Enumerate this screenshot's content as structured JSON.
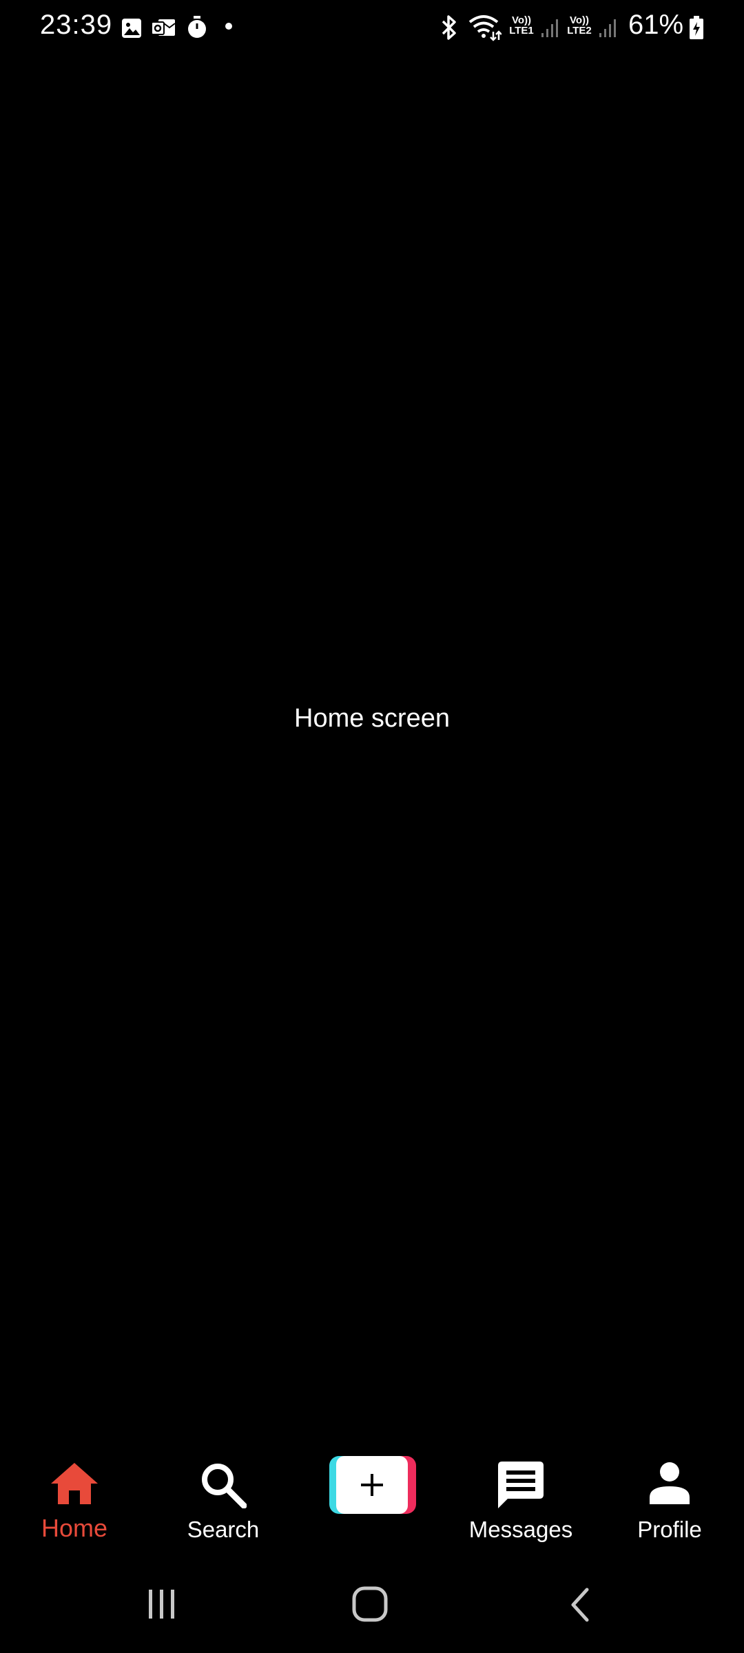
{
  "status_bar": {
    "time": "23:39",
    "notification_icons": [
      "gallery-icon",
      "outlook-icon",
      "timer-icon",
      "dot-icon"
    ],
    "right_icons": [
      "bluetooth-icon",
      "wifi-icon",
      "signal-icon"
    ],
    "sim1_label_top": "Vo))",
    "sim1_label_bottom": "LTE1",
    "sim2_label_top": "Vo))",
    "sim2_label_bottom": "LTE2",
    "battery_percent": "61%"
  },
  "main": {
    "center_text": "Home screen"
  },
  "bottom_nav": {
    "accent_color": "#e84a3a",
    "items": [
      {
        "label": "Home",
        "icon": "home-icon",
        "active": true
      },
      {
        "label": "Search",
        "icon": "search-icon",
        "active": false
      },
      {
        "label": "",
        "icon": "plus-icon",
        "active": false
      },
      {
        "label": "Messages",
        "icon": "message-icon",
        "active": false
      },
      {
        "label": "Profile",
        "icon": "person-icon",
        "active": false
      }
    ]
  },
  "system_nav": {
    "buttons": [
      "recents-icon",
      "home-circle-icon",
      "back-icon"
    ]
  }
}
